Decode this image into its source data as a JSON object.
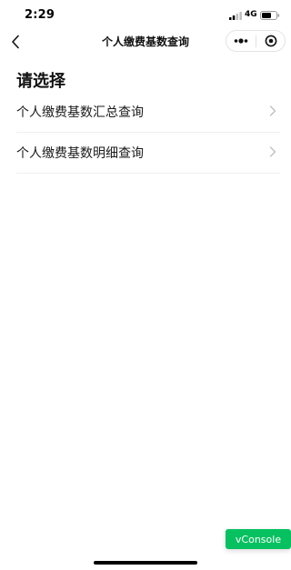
{
  "status_bar": {
    "time": "2:29",
    "network": "4G",
    "icons": [
      "signal-icon",
      "battery-icon"
    ]
  },
  "nav": {
    "title": "个人缴费基数查询",
    "back_icon": "chevron-left-icon",
    "more_icon": "more-dots-icon",
    "close_icon": "target-circle-icon"
  },
  "content": {
    "heading": "请选择",
    "items": [
      {
        "label": "个人缴费基数汇总查询",
        "icon": "chevron-right-icon"
      },
      {
        "label": "个人缴费基数明细查询",
        "icon": "chevron-right-icon"
      }
    ]
  },
  "vconsole": {
    "label": "vConsole"
  },
  "colors": {
    "accent": "#07c160",
    "divider": "#f0f0f0",
    "chevron": "#c0c0c0"
  }
}
